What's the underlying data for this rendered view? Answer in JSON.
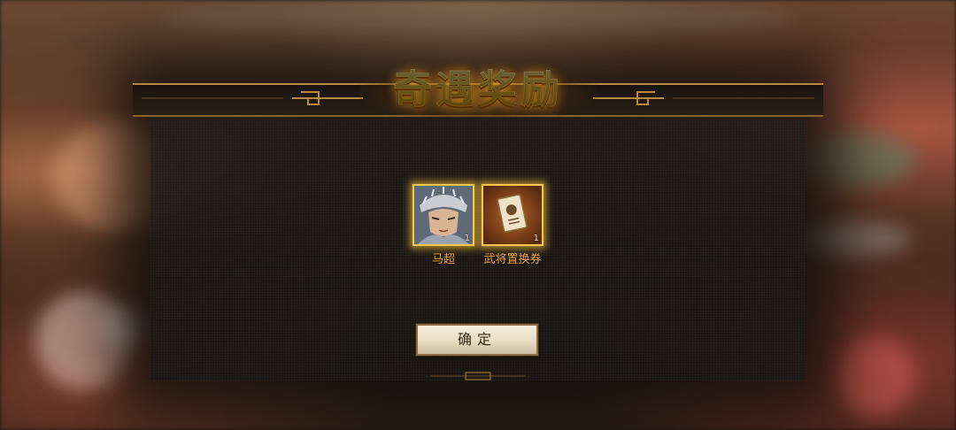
{
  "dialog": {
    "title": "奇遇奖励",
    "confirm_label": "确定"
  },
  "rewards": [
    {
      "name": "马超",
      "count": "1",
      "icon": "general-portrait-icon"
    },
    {
      "name": "武将置换券",
      "count": "1",
      "icon": "exchange-ticket-icon"
    }
  ],
  "colors": {
    "title_gold": "#ffcf3e",
    "frame_gold": "#f5c84a",
    "item_name": "#f0a83a",
    "button_bg": "#efe4cf"
  }
}
